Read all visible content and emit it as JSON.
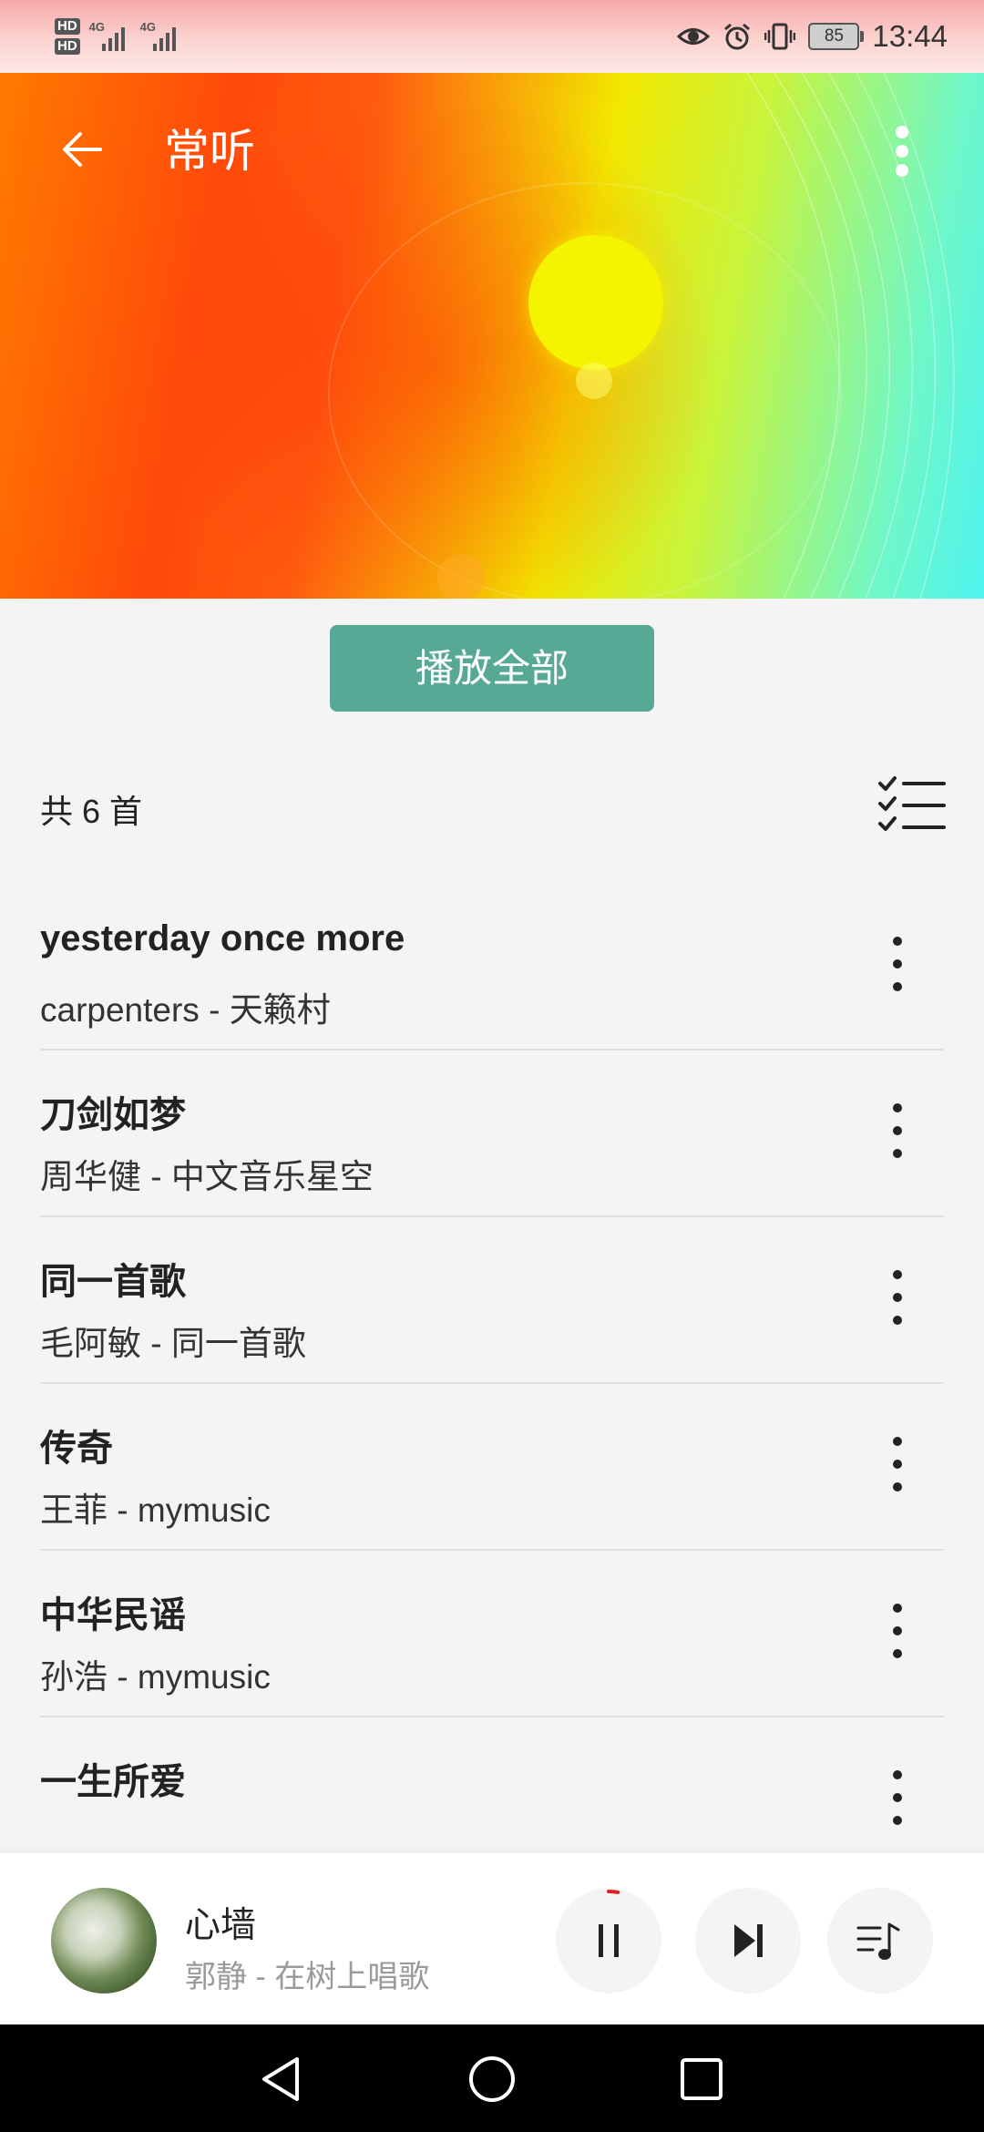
{
  "status_bar": {
    "hd1": "HD",
    "hd2": "HD",
    "net1_label": "4G",
    "net2_label": "4G",
    "battery": "85",
    "time": "13:44"
  },
  "header": {
    "title": "常听",
    "back_icon": "arrow-left-icon",
    "more_icon": "vertical-dots-icon"
  },
  "actions": {
    "play_all": "播放全部",
    "count": "共 6 首",
    "multi_select_icon": "checklist-icon"
  },
  "songs": [
    {
      "title": "yesterday once more",
      "subtitle": "carpenters - 天籁村"
    },
    {
      "title": "刀剑如梦",
      "subtitle": "周华健 - 中文音乐星空"
    },
    {
      "title": "同一首歌",
      "subtitle": "毛阿敏 - 同一首歌"
    },
    {
      "title": "传奇",
      "subtitle": "王菲 - mymusic"
    },
    {
      "title": "中华民谣",
      "subtitle": "孙浩 - mymusic"
    },
    {
      "title": "一生所爱",
      "subtitle": ""
    }
  ],
  "now_playing": {
    "title": "心墙",
    "subtitle": "郭静 - 在树上唱歌",
    "progress": 0.03,
    "accent_color": "#e02020"
  },
  "colors": {
    "play_all_bg": "#57a995",
    "page_bg": "#f4f4f4"
  }
}
